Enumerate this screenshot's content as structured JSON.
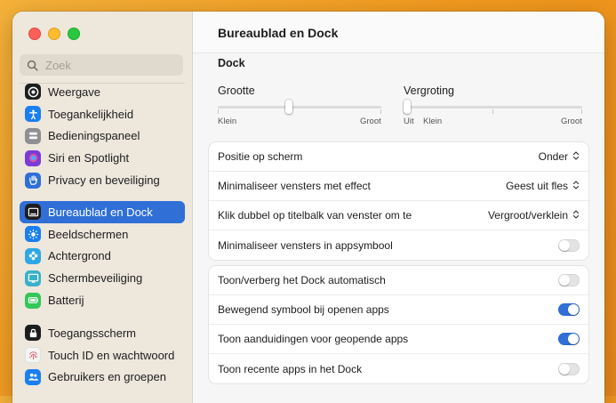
{
  "search": {
    "placeholder": "Zoek"
  },
  "sidebar": {
    "group1": [
      {
        "label": "Weergave",
        "icon": "accessibility-circle-icon",
        "color": "#1d1d1f"
      },
      {
        "label": "Toegankelijkheid",
        "icon": "accessibility-icon",
        "color": "#1a7ff0"
      },
      {
        "label": "Bedieningspaneel",
        "icon": "control-center-icon",
        "color": "#8e8e93"
      },
      {
        "label": "Siri en Spotlight",
        "icon": "siri-icon",
        "color": "#7a3cd6"
      },
      {
        "label": "Privacy en beveiliging",
        "icon": "hand-icon",
        "color": "#2f6fd6"
      }
    ],
    "group2": [
      {
        "label": "Bureaublad en Dock",
        "icon": "dock-icon",
        "color": "#1d1d1f",
        "active": true
      },
      {
        "label": "Beeldschermen",
        "icon": "display-sun-icon",
        "color": "#1a7ff0"
      },
      {
        "label": "Achtergrond",
        "icon": "wallpaper-flower-icon",
        "color": "#2fa7e6"
      },
      {
        "label": "Schermbeveiliging",
        "icon": "screensaver-icon",
        "color": "#3bb0c9"
      },
      {
        "label": "Batterij",
        "icon": "battery-icon",
        "color": "#34c759"
      }
    ],
    "group3": [
      {
        "label": "Toegangsscherm",
        "icon": "lock-icon",
        "color": "#1d1d1f"
      },
      {
        "label": "Touch ID en wachtwoord",
        "icon": "fingerprint-icon",
        "color": "#f5f5f5"
      },
      {
        "label": "Gebruikers en groepen",
        "icon": "users-icon",
        "color": "#1a7ff0"
      }
    ]
  },
  "main": {
    "title": "Bureaublad en Dock",
    "section": "Dock",
    "size_slider": {
      "label": "Grootte",
      "min_label": "Klein",
      "max_label": "Groot",
      "value": 0.43
    },
    "magnify_slider": {
      "label": "Vergroting",
      "off_label": "Uit",
      "min_label": "Klein",
      "max_label": "Groot",
      "value": 0.0
    },
    "rows1": [
      {
        "label": "Positie op scherm",
        "type": "popup",
        "value": "Onder"
      },
      {
        "label": "Minimaliseer vensters met effect",
        "type": "popup",
        "value": "Geest uit fles"
      },
      {
        "label": "Klik dubbel op titelbalk van venster om te",
        "type": "popup",
        "value": "Vergroot/verklein"
      },
      {
        "label": "Minimaliseer vensters in appsymbool",
        "type": "toggle",
        "value": false
      }
    ],
    "rows2": [
      {
        "label": "Toon/verberg het Dock automatisch",
        "type": "toggle",
        "value": false
      },
      {
        "label": "Bewegend symbool bij openen apps",
        "type": "toggle",
        "value": true
      },
      {
        "label": "Toon aanduidingen voor geopende apps",
        "type": "toggle",
        "value": true
      },
      {
        "label": "Toon recente apps in het Dock",
        "type": "toggle",
        "value": false
      }
    ]
  },
  "colors": {
    "accent": "#2f6fd6",
    "sidebar_bg": "#ede7dc"
  }
}
